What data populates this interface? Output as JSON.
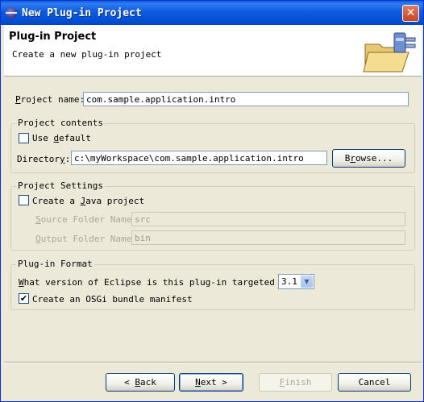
{
  "window": {
    "title": "New Plug-in Project",
    "close_glyph": "✕"
  },
  "header": {
    "title": "Plug-in Project",
    "description": "Create a new plug-in project"
  },
  "project_name": {
    "label_prefix": "P",
    "label_rest": "roject name:",
    "value": "com.sample.application.intro"
  },
  "project_contents": {
    "legend": "Project contents",
    "use_default": {
      "label_pre": "Use ",
      "label_u": "d",
      "label_post": "efault",
      "checked": false
    },
    "directory": {
      "label_pre": "Director",
      "label_u": "y",
      "label_post": ":",
      "value": "c:\\myWorkspace\\com.sample.application.intro",
      "browse_pre": "B",
      "browse_u": "r",
      "browse_post": "owse..."
    }
  },
  "project_settings": {
    "legend": "Project Settings",
    "create_java": {
      "label_pre": "Create a ",
      "label_u": "J",
      "label_post": "ava project",
      "checked": false
    },
    "source_folder": {
      "label_u": "S",
      "label_rest": "ource Folder Name:",
      "value": "src"
    },
    "output_folder": {
      "label_u": "O",
      "label_rest": "utput Folder Name:",
      "value": "bin"
    }
  },
  "plugin_format": {
    "legend": "Plug-in Format",
    "version_question_pre": "",
    "version_question_u": "W",
    "version_question_post": "hat version of Eclipse is this plug-in targeted for?",
    "version_value": "3.1",
    "osgi": {
      "label_pre": "Create an OSGi bundle manifest",
      "checked": true
    }
  },
  "buttons": {
    "back_pre": "< ",
    "back_u": "B",
    "back_post": "ack",
    "next_u": "N",
    "next_post": "ext >",
    "finish_u": "F",
    "finish_post": "inish",
    "cancel": "Cancel"
  },
  "icons": {
    "app": "eclipse-icon",
    "wizard": "plugin-folder-icon",
    "check": "✔",
    "dropdown": "▼"
  }
}
